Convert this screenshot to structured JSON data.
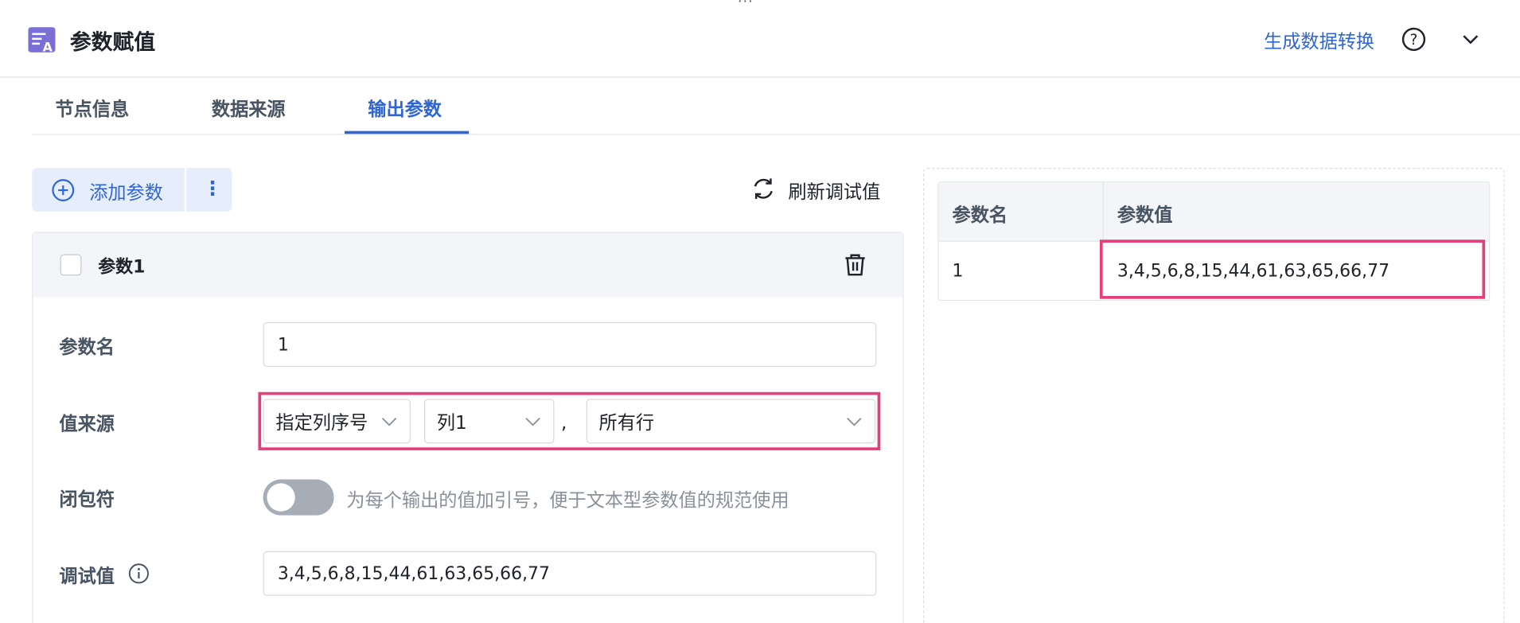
{
  "header": {
    "title": "参数赋值",
    "generate_link": "生成数据转换",
    "drag_handle": "···"
  },
  "tabs": [
    {
      "label": "节点信息",
      "active": false
    },
    {
      "label": "数据来源",
      "active": false
    },
    {
      "label": "输出参数",
      "active": true
    }
  ],
  "toolbar": {
    "add_param_label": "添加参数",
    "more_label": "⋮",
    "refresh_label": "刷新调试值"
  },
  "param_card": {
    "title": "参数1",
    "fields": {
      "name_label": "参数名",
      "name_value": "1",
      "source_label": "值来源",
      "source_type": "指定列序号",
      "source_column": "列1",
      "separator": ",",
      "source_rows": "所有行",
      "closure_label": "闭包符",
      "closure_enabled": false,
      "closure_desc": "为每个输出的值加引号，便于文本型参数值的规范使用",
      "debug_label": "调试值",
      "debug_value": "3,4,5,6,8,15,44,61,63,65,66,77"
    }
  },
  "result_table": {
    "headers": [
      "参数名",
      "参数值"
    ],
    "rows": [
      {
        "name": "1",
        "value": "3,4,5,6,8,15,44,61,63,65,66,77"
      }
    ]
  },
  "colors": {
    "accent": "#2f66d6",
    "highlight": "#e63e7a",
    "header_bg": "#f3f5f8",
    "button_bg": "#e6eefc"
  },
  "icons": {
    "app": "param-assign-icon",
    "help": "question-circle-icon",
    "collapse": "chevron-down-icon",
    "add": "plus-circle-icon",
    "refresh": "refresh-icon",
    "delete": "trash-icon",
    "info": "info-circle-icon"
  }
}
